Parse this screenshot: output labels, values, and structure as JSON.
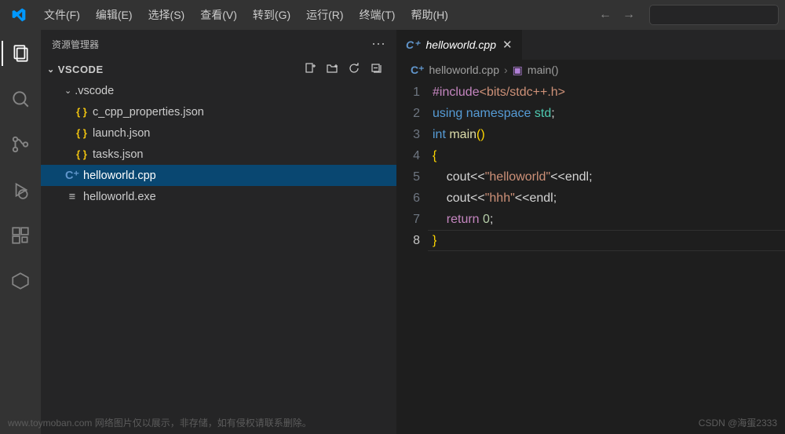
{
  "menu": {
    "items": [
      "文件(F)",
      "编辑(E)",
      "选择(S)",
      "查看(V)",
      "转到(G)",
      "运行(R)",
      "终端(T)",
      "帮助(H)"
    ]
  },
  "sidebar": {
    "title": "资源管理器",
    "folder": "VSCODE",
    "toolbar": {
      "newfile": "＋",
      "newfolder": "⊞",
      "refresh": "↻",
      "collapse": "⊟"
    },
    "tree": {
      "dir": ".vscode",
      "files": [
        "c_cpp_properties.json",
        "launch.json",
        "tasks.json"
      ],
      "root_files": [
        {
          "name": "helloworld.cpp",
          "icon": "cpp",
          "selected": true
        },
        {
          "name": "helloworld.exe",
          "icon": "exe",
          "selected": false
        }
      ]
    }
  },
  "tab": {
    "icon": "C⁺",
    "name": "helloworld.cpp"
  },
  "breadcrumb": {
    "file": "helloworld.cpp",
    "func": "main()"
  },
  "code": {
    "lines": [
      {
        "n": 1,
        "tokens": [
          [
            "kw-preproc",
            "#include"
          ],
          [
            "hdr",
            "<bits/stdc++.h>"
          ]
        ]
      },
      {
        "n": 2,
        "tokens": [
          [
            "kw-blue",
            "using "
          ],
          [
            "kw-blue",
            "namespace "
          ],
          [
            "ns",
            "std"
          ],
          [
            "txt",
            ";"
          ]
        ]
      },
      {
        "n": 3,
        "tokens": [
          [
            "kw-type",
            "int "
          ],
          [
            "fn",
            "main"
          ],
          [
            "brace-y",
            "()"
          ]
        ]
      },
      {
        "n": 4,
        "tokens": [
          [
            "brace-y",
            "{"
          ]
        ]
      },
      {
        "n": 5,
        "tokens": [
          [
            "pipe",
            "    "
          ],
          [
            "txt",
            "cout<<"
          ],
          [
            "str",
            "\"helloworld\""
          ],
          [
            "txt",
            "<<endl;"
          ]
        ]
      },
      {
        "n": 6,
        "tokens": [
          [
            "pipe",
            "    "
          ],
          [
            "txt",
            "cout<<"
          ],
          [
            "str",
            "\"hhh\""
          ],
          [
            "txt",
            "<<endl;"
          ]
        ]
      },
      {
        "n": 7,
        "tokens": [
          [
            "pipe",
            "    "
          ],
          [
            "pink",
            "return "
          ],
          [
            "num",
            "0"
          ],
          [
            "txt",
            ";"
          ]
        ]
      },
      {
        "n": 8,
        "tokens": [
          [
            "brace-y",
            "}"
          ]
        ],
        "current": true
      }
    ]
  },
  "watermark": {
    "left": "www.toymoban.com  网络图片仅以展示，非存储，如有侵权请联系删除。",
    "right": "CSDN @海蛋2333"
  }
}
